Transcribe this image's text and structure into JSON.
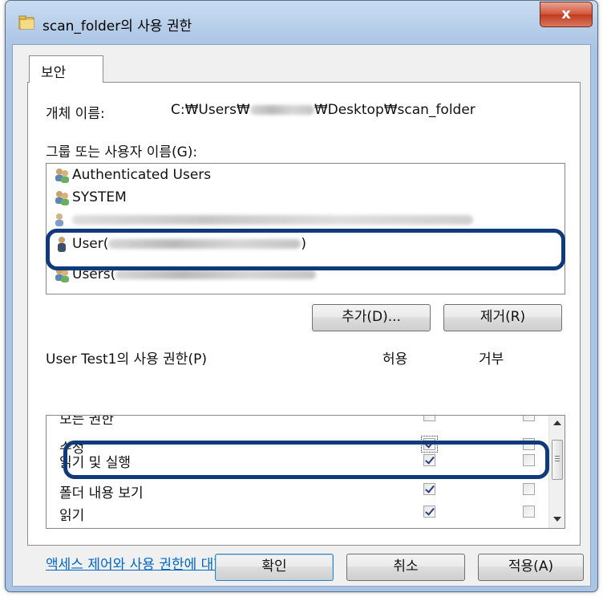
{
  "window": {
    "title": "scan_folder의 사용 권한",
    "close_label": "x"
  },
  "tab": {
    "label": "보안"
  },
  "object_name": {
    "label": "개체 이름:",
    "path_prefix": "C:₩Users₩",
    "path_suffix": "₩Desktop₩scan_folder"
  },
  "groups": {
    "label": "그룹 또는 사용자 이름(G):",
    "items": [
      {
        "name": "Authenticated Users"
      },
      {
        "name": "SYSTEM"
      },
      {
        "name": "User(",
        "suffix": ")"
      },
      {
        "name": "Users("
      }
    ]
  },
  "buttons": {
    "add": "추가(D)...",
    "remove": "제거(R)",
    "ok": "확인",
    "cancel": "취소",
    "apply": "적용(A)"
  },
  "permissions": {
    "label": "User Test1의 사용 권한(P)",
    "allow_header": "허용",
    "deny_header": "거부",
    "rows": [
      {
        "name": "모든 권한",
        "allow": false,
        "deny": false
      },
      {
        "name": "수정",
        "allow": true,
        "deny": false
      },
      {
        "name": "읽기 및 실행",
        "allow": true,
        "deny": false
      },
      {
        "name": "폴더 내용 보기",
        "allow": true,
        "deny": false
      },
      {
        "name": "읽기",
        "allow": true,
        "deny": false
      }
    ]
  },
  "info_link": "액세스 제어와 사용 권한에 대한 정보"
}
